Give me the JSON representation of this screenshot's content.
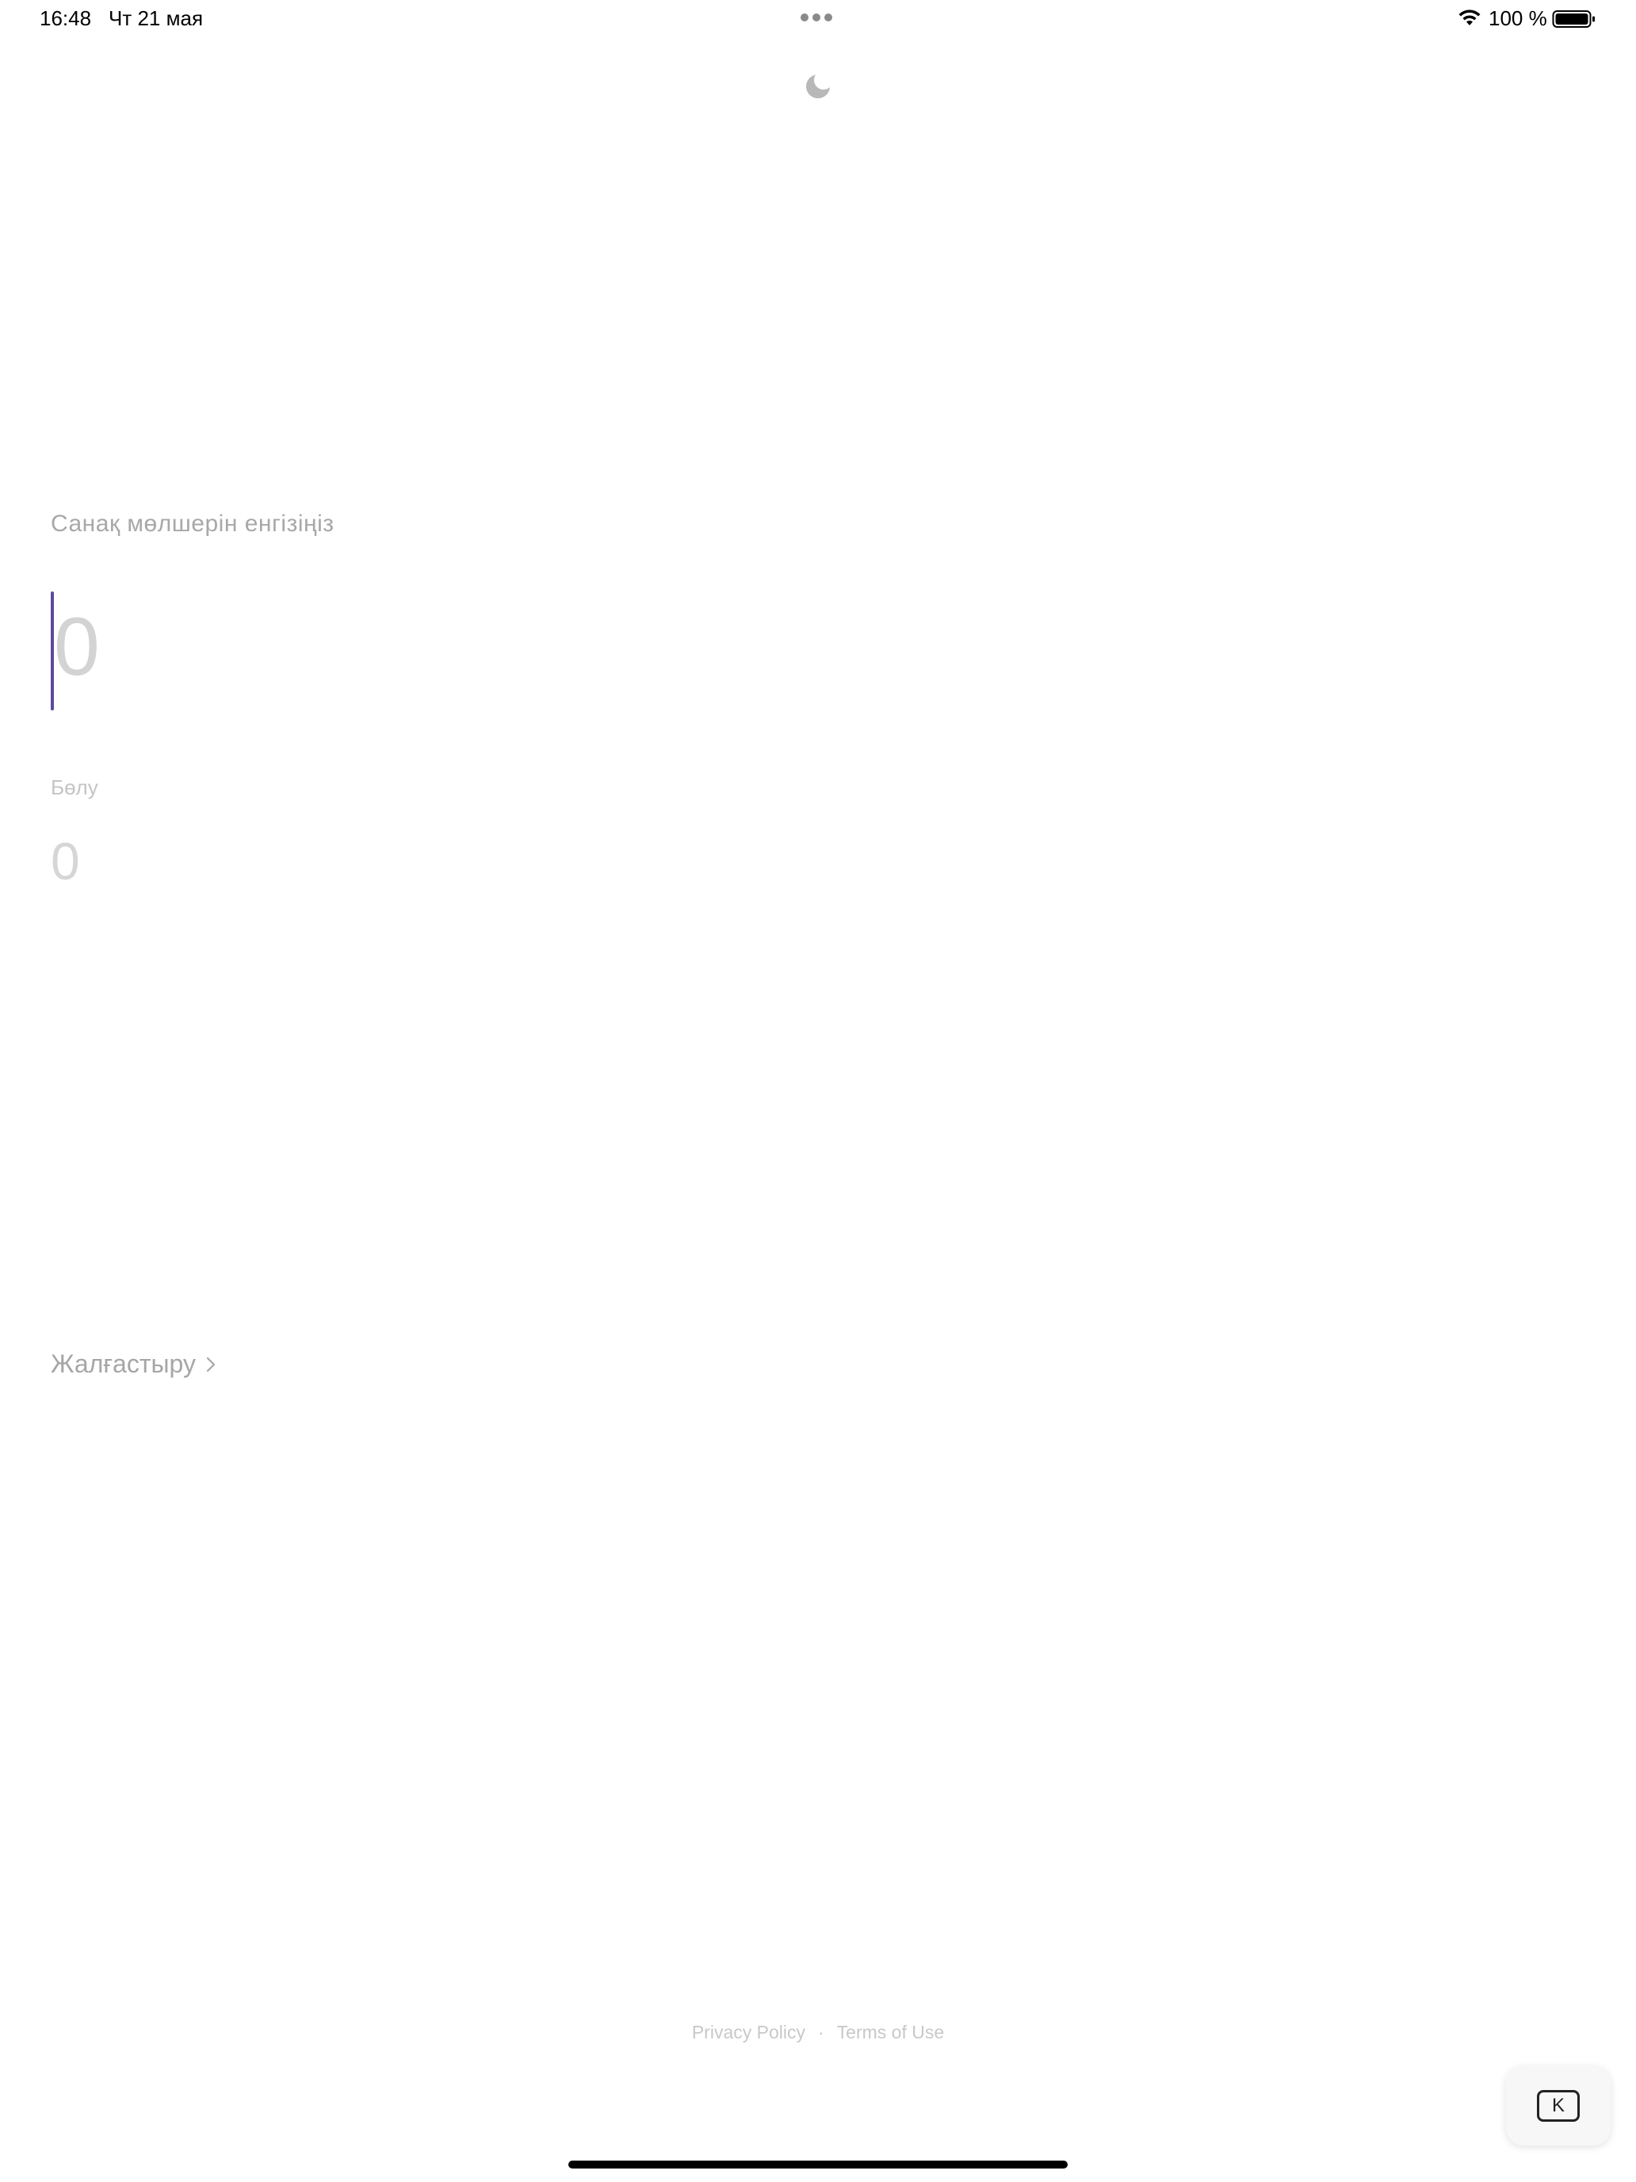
{
  "status_bar": {
    "time": "16:48",
    "date": "Чт 21 мая",
    "battery_percent": "100 %",
    "battery_level": 1.0,
    "wifi_icon": "wifi-icon",
    "battery_icon": "battery-icon"
  },
  "header": {
    "theme_icon": "moon-icon"
  },
  "form": {
    "prompt_label": "Санақ мөлшерін енгізіңіз",
    "amount_placeholder": "0",
    "divide_label": "Бөлу",
    "divide_value": "0",
    "continue_label": "Жалғастыру",
    "caret_color": "#5c4a9e"
  },
  "footer": {
    "privacy_label": "Privacy Policy",
    "separator": "·",
    "terms_label": "Terms of Use"
  },
  "keyboard_button": {
    "key_label": "K"
  }
}
